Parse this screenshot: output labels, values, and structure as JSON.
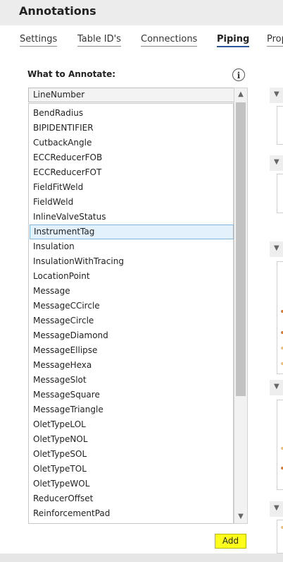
{
  "header": {
    "title": "Annotations"
  },
  "tabs": [
    {
      "label": "Settings",
      "active": false
    },
    {
      "label": "Table ID's",
      "active": false
    },
    {
      "label": "Connections",
      "active": false
    },
    {
      "label": "Piping",
      "active": true
    },
    {
      "label": "Prop",
      "active": false
    }
  ],
  "panel": {
    "label": "What to Annotate:",
    "info_icon": "info-icon",
    "selected_value": "LineNumber",
    "selected_item": "InstrumentTag",
    "items": [
      "BendRadius",
      "BIPIDENTIFIER",
      "CutbackAngle",
      "ECCReducerFOB",
      "ECCReducerFOT",
      "FieldFitWeld",
      "FieldWeld",
      "InlineValveStatus",
      "InstrumentTag",
      "Insulation",
      "InsulationWithTracing",
      "LocationPoint",
      "Message",
      "MessageCCircle",
      "MessageCircle",
      "MessageDiamond",
      "MessageEllipse",
      "MessageHexa",
      "MessageSlot",
      "MessageSquare",
      "MessageTriangle",
      "OletTypeLOL",
      "OletTypeNOL",
      "OletTypeSOL",
      "OletTypeTOL",
      "OletTypeWOL",
      "ReducerOffset",
      "ReinforcementPad"
    ],
    "add_label": "Add"
  },
  "colors": {
    "accent": "#2b579a",
    "add_button": "#ffff1a",
    "selection": "#e2f1fb",
    "selection_border": "#7fb6df",
    "marker_orange": "#e07a2a"
  }
}
